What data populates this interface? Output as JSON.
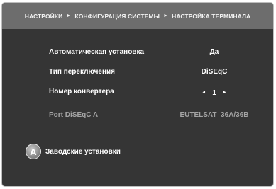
{
  "breadcrumb": {
    "items": [
      "НАСТРОЙКИ",
      "КОНФИГУРАЦИЯ СИСТЕМЫ",
      "НАСТРОЙКА ТЕРМИНАЛА"
    ],
    "separator": "►"
  },
  "settings": [
    {
      "label": "Автоматическая установка",
      "value": "Да"
    },
    {
      "label": "Тип переключения",
      "value": "DiSEqC"
    },
    {
      "label": "Номер конвертера",
      "value": "1",
      "left_arrow": "◄",
      "right_arrow": "►"
    },
    {
      "label": "Port DiSEqC A",
      "value": "EUTELSAT_36A/36B"
    }
  ],
  "footer": {
    "button_key": "A",
    "button_label": "Заводские установки"
  },
  "colors": {
    "background": "#353535",
    "header": "#6d6d6d",
    "text": "#ffffff",
    "disabled_text": "#a4a4a4"
  }
}
